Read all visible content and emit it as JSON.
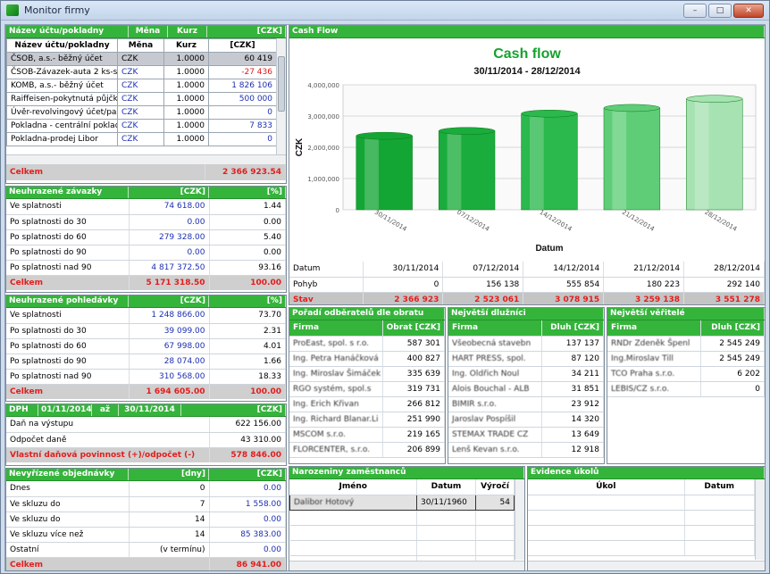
{
  "window": {
    "title": "Monitor firmy",
    "min": "–",
    "max": "□",
    "close": "✕"
  },
  "accounts": {
    "header": [
      "Název účtu/pokladny",
      "Měna",
      "Kurz",
      "[CZK]"
    ],
    "cols": [
      "Název účtu/pokladny",
      "Měna",
      "Kurz",
      "[CZK]"
    ],
    "rows": [
      [
        "ČSOB, a.s.- běžný účet",
        "CZK",
        "1.0000",
        "60 419"
      ],
      [
        "ČSOB-Závazek-auta 2 ks-s",
        "CZK",
        "1.0000",
        "-27 436"
      ],
      [
        "KOMB, a.s.- běžný účet",
        "CZK",
        "1.0000",
        "1 826 106"
      ],
      [
        "Raiffeisen-pokytnutá půjčk",
        "CZK",
        "1.0000",
        "500 000"
      ],
      [
        "Úvěr-revolvingový účet/pas",
        "CZK",
        "1.0000",
        "0"
      ],
      [
        "Pokladna - centrální poklad",
        "CZK",
        "1.0000",
        "7 833"
      ],
      [
        "Pokladna-prodej Libor",
        "CZK",
        "1.0000",
        "0"
      ]
    ],
    "total_label": "Celkem",
    "total": "2 366 923.54"
  },
  "zavazky": {
    "header": [
      "Neuhrazené závazky",
      "[CZK]",
      "[%]"
    ],
    "rows": [
      [
        "Ve splatnosti",
        "74 618.00",
        "1.44"
      ],
      [
        "Po splatnosti do 30",
        "0.00",
        "0.00"
      ],
      [
        "Po splatnosti do 60",
        "279 328.00",
        "5.40"
      ],
      [
        "Po splatnosti do 90",
        "0.00",
        "0.00"
      ],
      [
        "Po splatnosti nad 90",
        "4 817 372.50",
        "93.16"
      ]
    ],
    "total": [
      "Celkem",
      "5 171 318.50",
      "100.00"
    ]
  },
  "pohledavky": {
    "header": [
      "Neuhrazené pohledávky",
      "[CZK]",
      "[%]"
    ],
    "rows": [
      [
        "Ve splatnosti",
        "1 248 866.00",
        "73.70"
      ],
      [
        "Po splatnosti do 30",
        "39 099.00",
        "2.31"
      ],
      [
        "Po splatnosti do 60",
        "67 998.00",
        "4.01"
      ],
      [
        "Po splatnosti do 90",
        "28 074.00",
        "1.66"
      ],
      [
        "Po splatnosti nad 90",
        "310 568.00",
        "18.33"
      ]
    ],
    "total": [
      "Celkem",
      "1 694 605.00",
      "100.00"
    ]
  },
  "dph": {
    "header": [
      "DPH",
      "01/11/2014",
      "až",
      "30/11/2014",
      "[CZK]"
    ],
    "rows": [
      [
        "Daň na výstupu",
        "622 156.00"
      ],
      [
        "Odpočet daně",
        "43 310.00"
      ]
    ],
    "total": [
      "Vlastní daňová povinnost (+)/odpočet (-)",
      "578 846.00"
    ]
  },
  "objednavky": {
    "header": [
      "Nevyřízené objednávky",
      "[dny]",
      "[CZK]"
    ],
    "rows": [
      [
        "Dnes",
        "0",
        "0.00"
      ],
      [
        "Ve skluzu do",
        "7",
        "1 558.00"
      ],
      [
        "Ve skluzu do",
        "14",
        "0.00"
      ],
      [
        "Ve skluzu více než",
        "14",
        "85 383.00"
      ],
      [
        "Ostatní",
        "(v termínu)",
        "0.00"
      ]
    ],
    "total": [
      "Celkem",
      "86 941.00"
    ]
  },
  "cashflow": {
    "panel_title": "Cash Flow",
    "table": {
      "row_labels": [
        "Datum",
        "Pohyb",
        "Stav"
      ],
      "dates": [
        "30/11/2014",
        "07/12/2014",
        "14/12/2014",
        "21/12/2014",
        "28/12/2014"
      ],
      "pohyb": [
        "0",
        "156 138",
        "555 854",
        "180 223",
        "292 140"
      ],
      "stav": [
        "2 366 923",
        "2 523 061",
        "3 078 915",
        "3 259 138",
        "3 551 278"
      ]
    }
  },
  "chart_data": {
    "type": "bar",
    "title": "Cash flow",
    "subtitle": "30/11/2014 - 28/12/2014",
    "xlabel": "Datum",
    "ylabel": "CZK",
    "categories": [
      "30/11/2014",
      "07/12/2014",
      "14/12/2014",
      "21/12/2014",
      "28/12/2014"
    ],
    "values": [
      2366923,
      2523061,
      3078915,
      3259138,
      3551278
    ],
    "ylim": [
      0,
      4000000
    ],
    "yticks": [
      "0",
      "1,000,000",
      "2,000,000",
      "3,000,000",
      "4,000,000"
    ],
    "colors": [
      "#14a635",
      "#1aac3c",
      "#2bb84d",
      "#5fcd78",
      "#a6e2b2"
    ]
  },
  "odberatele": {
    "header": [
      "Pořadí odběratelů dle obratu"
    ],
    "cols": [
      "Firma",
      "Obrat [CZK]"
    ],
    "rows": [
      [
        "ProEast, spol. s r.o.",
        "587 301"
      ],
      [
        "Ing. Petra Hanáčková",
        "400 827"
      ],
      [
        "Ing. Miroslav Šimáček",
        "335 639"
      ],
      [
        "RGO systém, spol.s",
        "319 731"
      ],
      [
        "Ing. Erich Křivan",
        "266 812"
      ],
      [
        "Ing. Richard Blanar.Li",
        "251 990"
      ],
      [
        "MSCOM s.r.o.",
        "219 165"
      ],
      [
        "FLORCENTER, s.r.o.",
        "206 899"
      ]
    ]
  },
  "dluznici": {
    "header": [
      "Největší dlužníci"
    ],
    "cols": [
      "Firma",
      "Dluh [CZK]"
    ],
    "rows": [
      [
        "Všeobecná stavebn",
        "137 137"
      ],
      [
        "HART PRESS, spol.",
        "87 120"
      ],
      [
        "Ing. Oldřich Noul",
        "34 211"
      ],
      [
        "Alois Bouchal - ALB",
        "31 851"
      ],
      [
        "BIMIR s.r.o.",
        "23 912"
      ],
      [
        "Jaroslav Pospíšil",
        "14 320"
      ],
      [
        "STEMAX TRADE CZ",
        "13 649"
      ],
      [
        "Lenš Kevan s.r.o.",
        "12 918"
      ]
    ]
  },
  "veritele": {
    "header": [
      "Největší věřitelé"
    ],
    "cols": [
      "Firma",
      "Dluh [CZK]"
    ],
    "rows": [
      [
        "RNDr Zdeněk Špenl",
        "2 545 249"
      ],
      [
        "Ing.Miroslav Till",
        "2 545 249"
      ],
      [
        "TCO Praha s.r.o.",
        "6 202"
      ],
      [
        "LEBIS/CZ s.r.o.",
        "0"
      ]
    ]
  },
  "narozeniny": {
    "header": [
      "Narozeniny zaměstnanců"
    ],
    "cols": [
      "Jméno",
      "Datum",
      "Výročí"
    ],
    "rows": [
      [
        "Dalibor Hotový",
        "30/11/1960",
        "54"
      ]
    ]
  },
  "ukoly": {
    "header": [
      "Evidence úkolů"
    ],
    "cols": [
      "Úkol",
      "Datum"
    ]
  }
}
